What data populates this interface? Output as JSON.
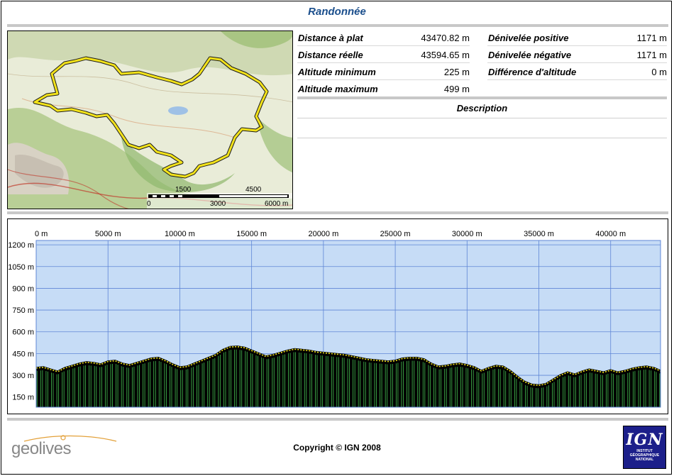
{
  "title": "Randonnée",
  "stats_left": [
    {
      "label": "Distance à plat",
      "value": "43470.82 m"
    },
    {
      "label": "Distance réelle",
      "value": "43594.65 m"
    },
    {
      "label": "Altitude minimum",
      "value": "225 m"
    },
    {
      "label": "Altitude maximum",
      "value": "499 m"
    }
  ],
  "stats_right": [
    {
      "label": "Dénivelée positive",
      "value": "1171 m"
    },
    {
      "label": "Dénivelée négative",
      "value": "1171 m"
    },
    {
      "label": "Différence d'altitude",
      "value": "0 m"
    }
  ],
  "description": {
    "title": "Description",
    "text": ""
  },
  "map": {
    "scale_labels_top": [
      "1500",
      "4500"
    ],
    "scale_labels_bottom": [
      "0",
      "3000",
      "6000 m"
    ],
    "route_color": "#f2e21a"
  },
  "chart_data": {
    "type": "area",
    "x_unit": "m",
    "x_ticks": [
      "0 m",
      "5000 m",
      "10000 m",
      "15000 m",
      "20000 m",
      "25000 m",
      "30000 m",
      "35000 m",
      "40000 m"
    ],
    "y_ticks": [
      "150 m",
      "300 m",
      "450 m",
      "600 m",
      "750 m",
      "900 m",
      "1050 m",
      "1200 m"
    ],
    "xlim": [
      0,
      43470.82
    ],
    "ylim": [
      80,
      1230
    ],
    "background_color": "#c6dcf6",
    "fill_color": "#000000",
    "line_color": "#f2e21a",
    "grid": true,
    "x": [
      0,
      500,
      1000,
      1500,
      2000,
      2500,
      3000,
      3500,
      4000,
      4500,
      5000,
      5500,
      6000,
      6500,
      7000,
      7500,
      8000,
      8500,
      9000,
      9500,
      10000,
      10500,
      11000,
      11500,
      12000,
      12500,
      13000,
      13500,
      14000,
      14500,
      15000,
      15500,
      16000,
      16500,
      17000,
      17500,
      18000,
      18500,
      19000,
      19500,
      20000,
      20500,
      21000,
      21500,
      22000,
      22500,
      23000,
      23500,
      24000,
      24500,
      25000,
      25500,
      26000,
      26500,
      27000,
      27500,
      28000,
      28500,
      29000,
      29500,
      30000,
      30500,
      31000,
      31500,
      32000,
      32500,
      33000,
      33500,
      34000,
      34500,
      35000,
      35500,
      36000,
      36500,
      37000,
      37500,
      38000,
      38500,
      39000,
      39500,
      40000,
      40500,
      41000,
      41500,
      42000,
      42500,
      43000,
      43470
    ],
    "y": [
      350,
      355,
      340,
      325,
      350,
      365,
      380,
      390,
      385,
      375,
      395,
      400,
      380,
      370,
      385,
      400,
      415,
      420,
      400,
      375,
      355,
      360,
      380,
      400,
      420,
      440,
      475,
      495,
      498,
      490,
      470,
      450,
      430,
      440,
      455,
      470,
      480,
      475,
      470,
      460,
      455,
      450,
      445,
      440,
      430,
      420,
      410,
      405,
      400,
      395,
      400,
      415,
      420,
      420,
      410,
      380,
      360,
      365,
      375,
      380,
      370,
      355,
      330,
      350,
      365,
      360,
      330,
      290,
      255,
      235,
      230,
      240,
      270,
      300,
      320,
      305,
      325,
      340,
      330,
      320,
      335,
      320,
      330,
      345,
      355,
      360,
      350,
      330
    ]
  },
  "footer": {
    "copyright": "Copyright © IGN 2008",
    "geolives_logo": "geolives",
    "ign_logo": "IGN",
    "ign_subtitle": [
      "INSTITUT",
      "GÉOGRAPHIQUE",
      "NATIONAL"
    ]
  }
}
